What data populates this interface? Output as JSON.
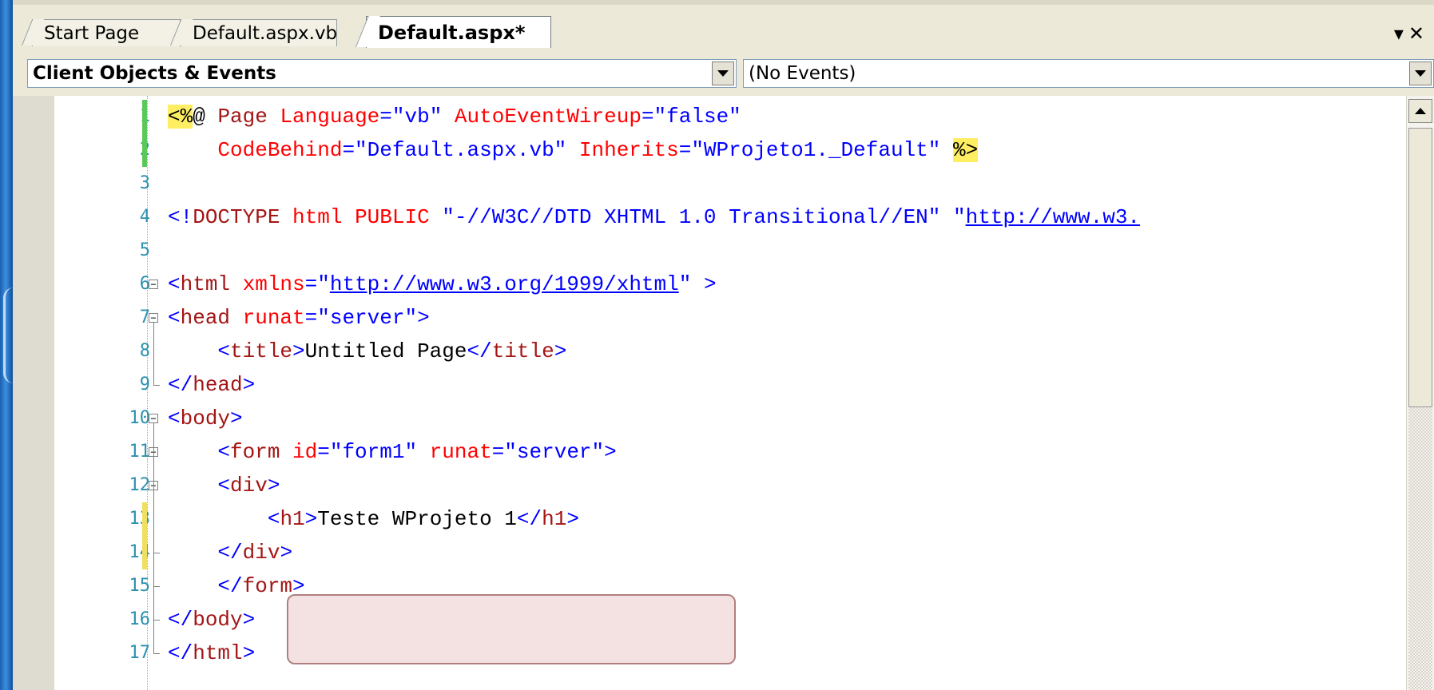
{
  "tabs": [
    {
      "label": "Start Page",
      "active": false
    },
    {
      "label": "Default.aspx.vb",
      "active": false
    },
    {
      "label": "Default.aspx*",
      "active": true
    }
  ],
  "window_controls": {
    "dropdown": "▾",
    "close": "✕"
  },
  "combos": {
    "objects": {
      "value": "Client Objects & Events"
    },
    "events": {
      "value": "(No Events)"
    }
  },
  "editor": {
    "line_numbers": [
      "1",
      "2",
      "3",
      "4",
      "5",
      "6",
      "7",
      "8",
      "9",
      "10",
      "11",
      "12",
      "13",
      "14",
      "15",
      "16",
      "17"
    ],
    "lines": [
      [
        {
          "t": "<%",
          "c": "hl"
        },
        {
          "t": "@ ",
          "c": "k"
        },
        {
          "t": "Page ",
          "c": "m"
        },
        {
          "t": "Language",
          "c": "r"
        },
        {
          "t": "=\"vb\" ",
          "c": "b"
        },
        {
          "t": "AutoEventWireup",
          "c": "r"
        },
        {
          "t": "=\"false\"",
          "c": "b"
        }
      ],
      [
        {
          "t": "    CodeBehind",
          "c": "r"
        },
        {
          "t": "=\"Default.aspx.vb\" ",
          "c": "b"
        },
        {
          "t": "Inherits",
          "c": "r"
        },
        {
          "t": "=\"WProjeto1._Default\" ",
          "c": "b"
        },
        {
          "t": "%>",
          "c": "hl"
        }
      ],
      [],
      [
        {
          "t": "<!",
          "c": "b"
        },
        {
          "t": "DOCTYPE ",
          "c": "m"
        },
        {
          "t": "html ",
          "c": "r"
        },
        {
          "t": "PUBLIC ",
          "c": "r"
        },
        {
          "t": "\"-//W3C//DTD XHTML 1.0 Transitional//EN\" \"",
          "c": "b"
        },
        {
          "t": "http://www.w3.",
          "c": "u"
        }
      ],
      [],
      [
        {
          "t": "<",
          "c": "b"
        },
        {
          "t": "html ",
          "c": "m"
        },
        {
          "t": "xmlns",
          "c": "r"
        },
        {
          "t": "=\"",
          "c": "b"
        },
        {
          "t": "http://www.w3.org/1999/xhtml",
          "c": "u"
        },
        {
          "t": "\" >",
          "c": "b"
        }
      ],
      [
        {
          "t": "<",
          "c": "b"
        },
        {
          "t": "head ",
          "c": "m"
        },
        {
          "t": "runat",
          "c": "r"
        },
        {
          "t": "=\"server\">",
          "c": "b"
        }
      ],
      [
        {
          "t": "    <",
          "c": "b"
        },
        {
          "t": "title",
          "c": "m"
        },
        {
          "t": ">",
          "c": "b"
        },
        {
          "t": "Untitled Page",
          "c": "k"
        },
        {
          "t": "</",
          "c": "b"
        },
        {
          "t": "title",
          "c": "m"
        },
        {
          "t": ">",
          "c": "b"
        }
      ],
      [
        {
          "t": "</",
          "c": "b"
        },
        {
          "t": "head",
          "c": "m"
        },
        {
          "t": ">",
          "c": "b"
        }
      ],
      [
        {
          "t": "<",
          "c": "b"
        },
        {
          "t": "body",
          "c": "m"
        },
        {
          "t": ">",
          "c": "b"
        }
      ],
      [
        {
          "t": "    <",
          "c": "b"
        },
        {
          "t": "form ",
          "c": "m"
        },
        {
          "t": "id",
          "c": "r"
        },
        {
          "t": "=\"form1\" ",
          "c": "b"
        },
        {
          "t": "runat",
          "c": "r"
        },
        {
          "t": "=\"server\">",
          "c": "b"
        }
      ],
      [
        {
          "t": "    <",
          "c": "b"
        },
        {
          "t": "div",
          "c": "m"
        },
        {
          "t": ">",
          "c": "b"
        }
      ],
      [
        {
          "t": "        <",
          "c": "b"
        },
        {
          "t": "h1",
          "c": "m"
        },
        {
          "t": ">",
          "c": "b"
        },
        {
          "t": "Teste WProjeto 1",
          "c": "k"
        },
        {
          "t": "</",
          "c": "b"
        },
        {
          "t": "h1",
          "c": "m"
        },
        {
          "t": ">",
          "c": "b"
        }
      ],
      [
        {
          "t": "    </",
          "c": "b"
        },
        {
          "t": "div",
          "c": "m"
        },
        {
          "t": ">",
          "c": "b"
        }
      ],
      [
        {
          "t": "    </",
          "c": "b"
        },
        {
          "t": "form",
          "c": "m"
        },
        {
          "t": ">",
          "c": "b"
        }
      ],
      [
        {
          "t": "</",
          "c": "b"
        },
        {
          "t": "body",
          "c": "m"
        },
        {
          "t": ">",
          "c": "b"
        }
      ],
      [
        {
          "t": "</",
          "c": "b"
        },
        {
          "t": "html",
          "c": "m"
        },
        {
          "t": ">",
          "c": "b"
        }
      ]
    ]
  },
  "colors": {
    "accent_blue": "#0000ff",
    "tag_maroon": "#a31515",
    "attr_red": "#ff0000",
    "highlight": "#ffee62",
    "line_number": "#2b91af"
  }
}
